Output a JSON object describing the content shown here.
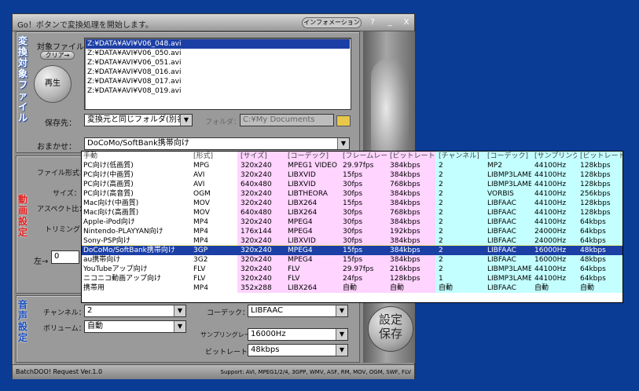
{
  "window": {
    "title": "Go！ボタンで変換処理を開始します。",
    "info_button": "インフォメーション",
    "help": "?",
    "min": "_",
    "close": "X"
  },
  "files_panel": {
    "tag": "変換対象ファイル",
    "target_label": "対象ファイル：",
    "clear_button": "クリア→",
    "play_button": "再生",
    "files": [
      "Z:¥DATA¥AVI¥V06_048.avi",
      "Z:¥DATA¥AVI¥V06_050.avi",
      "Z:¥DATA¥AVI¥V06_051.avi",
      "Z:¥DATA¥AVI¥V08_016.avi",
      "Z:¥DATA¥AVI¥V08_017.avi",
      "Z:¥DATA¥AVI¥V08_019.avi"
    ],
    "save_label": "保存先：",
    "save_value": "変換元と同じフォルダ(別名)",
    "folder_label": "フォルダ：",
    "folder_value": "C:¥My Documents",
    "preset_label": "おまかせ：",
    "preset_value": "DoCoMo/SoftBank携帯向け"
  },
  "video_panel": {
    "tag": "動画設定",
    "format_label": "ファイル形式：",
    "size_label": "サイズ：",
    "aspect_label": "アスペクト比：",
    "trim_label": "トリミング：",
    "left_label": "左→",
    "left_value": "0"
  },
  "audio_panel": {
    "tag": "音声設定",
    "channel_label": "チャンネル：",
    "channel_value": "2",
    "volume_label": "ボリューム：",
    "volume_value": "自動",
    "codec_label": "コーデック：",
    "codec_value": "LIBFAAC",
    "sample_label": "サンプリングレート：",
    "sample_value": "16000Hz",
    "bitrate_label": "ビットレート：",
    "bitrate_value": "48kbps"
  },
  "start_button": "設定\n保存",
  "status": {
    "left": "BatchDOO! Request Ver.1.0",
    "right": "Support: AVI, MPEG1/2/4, 3GPP, WMV, ASF, RM, MOV, OGM, SWF, FLV"
  },
  "dropdown": {
    "headers": [
      "手動",
      "[形式]",
      "[サイズ]",
      "[コーデック]",
      "[フレームレート]",
      "[ビットレート]",
      "[チャンネル]",
      "[コーデック]",
      "[サンプリングレート]",
      "[ビットレート]"
    ],
    "selected_index": 10,
    "rows": [
      [
        "PC向け(低画質)",
        "MPG",
        "320x240",
        "MPEG1 VIDEO",
        "29.97fps",
        "384kbps",
        "2",
        "MP2",
        "44100Hz",
        "128kbps"
      ],
      [
        "PC向け(中画質)",
        "AVI",
        "320x240",
        "LIBXVID",
        "15fps",
        "384kbps",
        "2",
        "LIBMP3LAME",
        "44100Hz",
        "128kbps"
      ],
      [
        "PC向け(高画質)",
        "AVI",
        "640x480",
        "LIBXVID",
        "30fps",
        "768kbps",
        "2",
        "LIBMP3LAME",
        "44100Hz",
        "128kbps"
      ],
      [
        "PC向け(高音質)",
        "OGM",
        "320x240",
        "LIBTHEORA",
        "30fps",
        "384kbps",
        "2",
        "VORBIS",
        "44100Hz",
        "256kbps"
      ],
      [
        "Mac向け(中画質)",
        "MOV",
        "320x240",
        "LIBX264",
        "15fps",
        "384kbps",
        "2",
        "LIBFAAC",
        "44100Hz",
        "128kbps"
      ],
      [
        "Mac向け(高画質)",
        "MOV",
        "640x480",
        "LIBX264",
        "30fps",
        "768kbps",
        "2",
        "LIBFAAC",
        "44100Hz",
        "128kbps"
      ],
      [
        "Apple-iPod向け",
        "MP4",
        "320x240",
        "MPEG4",
        "30fps",
        "384kbps",
        "2",
        "LIBFAAC",
        "44100Hz",
        "64kbps"
      ],
      [
        "Nintendo-PLAYYAN向け",
        "MP4",
        "176x144",
        "MPEG4",
        "30fps",
        "192kbps",
        "2",
        "LIBFAAC",
        "24000Hz",
        "64kbps"
      ],
      [
        "Sony-PSP向け",
        "MP4",
        "320x240",
        "LIBXVID",
        "30fps",
        "384kbps",
        "2",
        "LIBFAAC",
        "24000Hz",
        "64kbps"
      ],
      [
        "DoCoMo/SoftBank携帯向け",
        "3GP",
        "320x240",
        "MPEG4",
        "15fps",
        "384kbps",
        "2",
        "LIBFAAC",
        "16000Hz",
        "48kbps"
      ],
      [
        "au携帯向け",
        "3G2",
        "320x240",
        "MPEG4",
        "15fps",
        "384kbps",
        "2",
        "LIBFAAC",
        "16000Hz",
        "48kbps"
      ],
      [
        "YouTubeアップ向け",
        "FLV",
        "320x240",
        "FLV",
        "29.97fps",
        "216kbps",
        "2",
        "LIBMP3LAME",
        "44100Hz",
        "64kbps"
      ],
      [
        "ニコニコ動画アップ向け",
        "FLV",
        "320x240",
        "FLV",
        "24fps",
        "128kbps",
        "1",
        "LIBMP3LAME",
        "44100Hz",
        "64kbps"
      ],
      [
        "携帯用",
        "MP4",
        "352x288",
        "LIBX264",
        "自動",
        "自動",
        "自動",
        "LIBFAAC",
        "自動",
        "自動"
      ]
    ]
  }
}
